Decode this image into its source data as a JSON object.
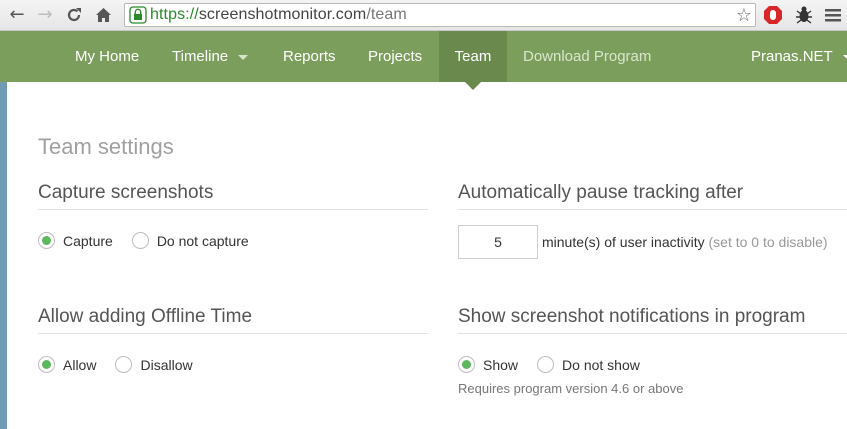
{
  "browser": {
    "url_scheme": "https://",
    "url_host": "screenshotmonitor.com",
    "url_path": "/team"
  },
  "navbar": {
    "items": [
      {
        "label": "My Home"
      },
      {
        "label": "Timeline"
      },
      {
        "label": "Reports"
      },
      {
        "label": "Projects"
      },
      {
        "label": "Team"
      },
      {
        "label": "Download Program"
      }
    ],
    "user": "Pranas.NET",
    "active": "Team",
    "color": "#7c9e5d"
  },
  "page": {
    "title": "Team settings"
  },
  "capture": {
    "title": "Capture screenshots",
    "options": [
      "Capture",
      "Do not capture"
    ],
    "selected": "Capture"
  },
  "pause": {
    "title": "Automatically pause tracking after",
    "value": "5",
    "text": "minute(s) of user inactivity",
    "hint": "(set to 0 to disable)"
  },
  "offline": {
    "title": "Allow adding Offline Time",
    "options": [
      "Allow",
      "Disallow"
    ],
    "selected": "Allow"
  },
  "notifications": {
    "title": "Show screenshot notifications in program",
    "options": [
      "Show",
      "Do not show"
    ],
    "selected": "Show",
    "note": "Requires program version 4.6 or above"
  },
  "colors": {
    "radio_checked": "#5cb85c",
    "accent_bar": "#6f9bb3"
  }
}
